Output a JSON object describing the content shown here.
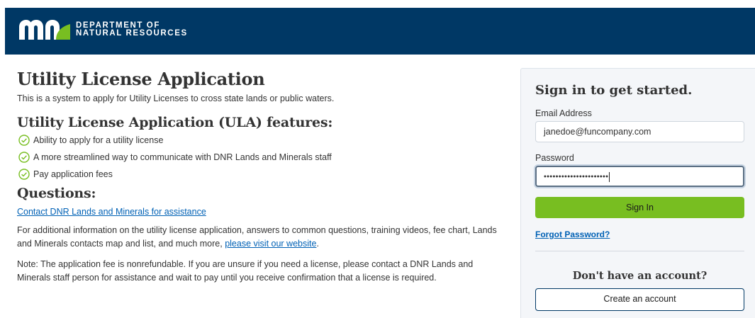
{
  "header": {
    "logo_line1": "DEPARTMENT OF",
    "logo_line2": "NATURAL RESOURCES",
    "brand_color": "#003865"
  },
  "main": {
    "title": "Utility License Application",
    "intro": "This is a system to apply for Utility Licenses to cross state lands or public waters.",
    "features_title": "Utility License Application (ULA) features:",
    "features": [
      "Ability to apply for a utility license",
      "A more streamlined way to communicate with DNR Lands and Minerals staff",
      "Pay application fees"
    ],
    "questions_title": "Questions:",
    "contact_link": "Contact DNR Lands and Minerals for assistance",
    "info_text": "For additional information on the utility license application, answers to common questions, training videos, fee chart, Lands and Minerals contacts map and list, and much more, ",
    "info_link": "please visit our website",
    "info_end": ".",
    "note_text": "Note: The application fee is nonrefundable. If you are unsure if you need a license, please contact a DNR Lands and Minerals staff person for assistance and wait to pay until you receive confirmation that a license is required."
  },
  "signin": {
    "title": "Sign in to get started.",
    "email_label": "Email Address",
    "email_value": "janedoe@funcompany.com",
    "password_label": "Password",
    "password_masked": "••••••••••••••••••••••",
    "signin_button": "Sign In",
    "forgot_link": "Forgot Password?",
    "no_account": "Don't have an account?",
    "create_button": "Create an account",
    "button_color": "#78be21"
  }
}
